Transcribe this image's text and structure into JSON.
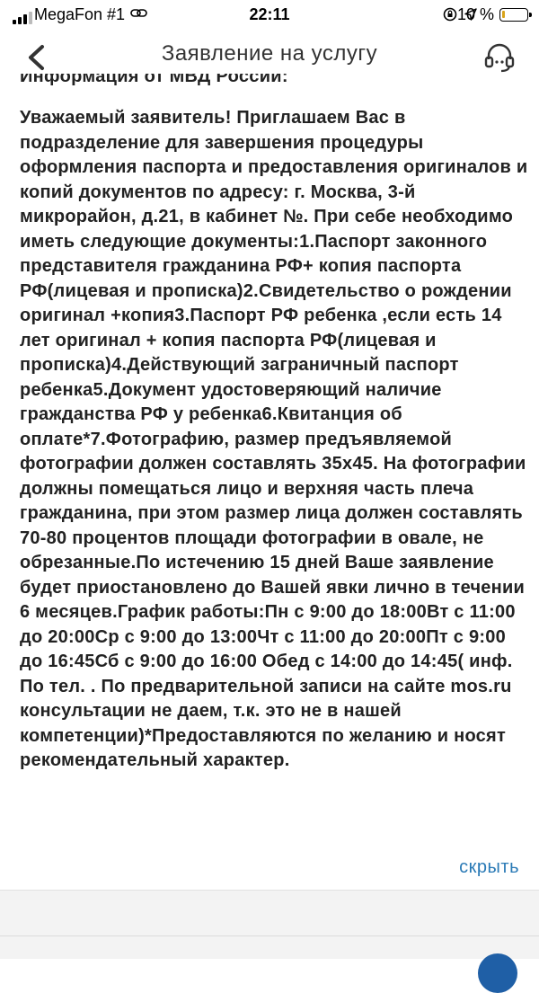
{
  "status": {
    "carrier": "MegaFon #1",
    "time": "22:11",
    "battery_pct": "10 %",
    "battery_level": 0.1,
    "icons": [
      "link-icon",
      "rotation-lock-icon",
      "location-arrow-icon"
    ]
  },
  "nav": {
    "title": "Заявление на услугу",
    "back_icon": "chevron-left-icon",
    "support_icon": "headset-icon"
  },
  "content": {
    "cut_header": "Информация от МВД России:",
    "message": "Уважаемый заявитель! Приглашаем Вас в подразделение для завершения процедуры оформления паспорта и предоставления оригиналов и копий документов по адресу: г. Москва, 3-й микрорайон, д.21, в кабинет №. При себе необходимо иметь следующие документы:1.Паспорт законного представителя гражданина РФ+ копия паспорта РФ(лицевая и прописка)2.Свидетельство о рождении оригинал +копия3.Паспорт РФ ребенка ,если есть 14 лет оригинал + копия паспорта РФ(лицевая и прописка)4.Действующий заграничный паспорт ребенка5.Документ удостоверяющий наличие гражданства РФ у ребенка6.Квитанция об оплате*7.Фотографию, размер предъявляемой фотографии должен составлять 35х45. На фотографии должны помещаться лицо и верхняя часть плеча гражданина, при этом размер лица должен составлять 70-80 процентов площади фотографии в овале, не обрезанные.По истечению 15 дней Ваше заявление будет приостановлено до Вашей явки лично в течении 6 месяцев.График работы:Пн с 9:00 до 18:00Вт с 11:00 до 20:00Ср с 9:00 до 13:00Чт с 11:00 до 20:00Пт с 9:00 до 16:45Сб с 9:00 до 16:00 Обед с 14:00 до 14:45( инф. По тел. . По предварительной записи на сайте mos.ru консультации не даем, т.к. это не в нашей компетенции)*Предоставляются по желанию и носят рекомендательный характер.",
    "hide_link": "скрыть"
  },
  "colors": {
    "accent": "#2a7ab6",
    "battery_low": "#d8a31a",
    "fab": "#1f5fa6"
  }
}
